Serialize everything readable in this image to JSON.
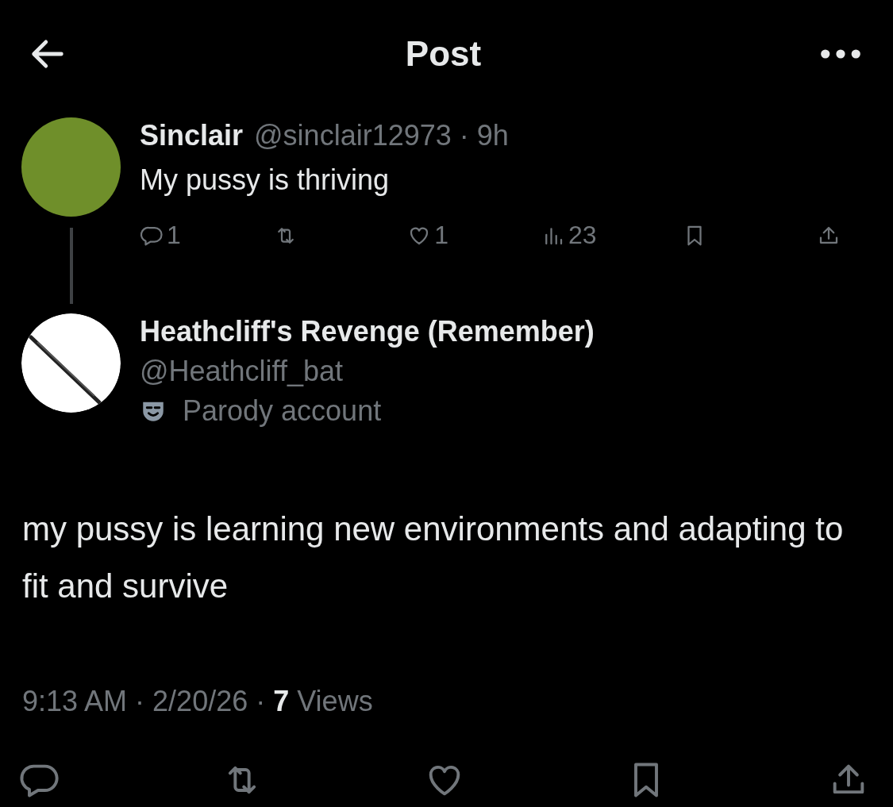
{
  "header": {
    "title": "Post"
  },
  "parent_post": {
    "name": "Sinclair",
    "handle_time": "@sinclair12973 · 9h",
    "text": "My pussy is thriving",
    "actions": [
      {
        "kind": "reply",
        "count": "1"
      },
      {
        "kind": "repost"
      },
      {
        "kind": "like",
        "count": "1"
      },
      {
        "kind": "views",
        "count": "23"
      },
      {
        "kind": "bookmark"
      },
      {
        "kind": "share"
      }
    ]
  },
  "post": {
    "name": "Heathcliff's Revenge (Remember)",
    "handle": "@Heathcliff_bat",
    "label": "Parody account",
    "text": "my pussy is learning new environments and adapting to fit and survive",
    "meta": [
      {
        "text": "9:13 AM",
        "kind": "plain"
      },
      {
        "text": "·",
        "kind": "plain"
      },
      {
        "text": "2/20/26",
        "kind": "plain"
      },
      {
        "text": "·",
        "kind": "plain"
      },
      {
        "text": "7",
        "kind": "bold"
      },
      {
        "text": "Views",
        "kind": "plain"
      }
    ],
    "actions": [
      {
        "kind": "reply"
      },
      {
        "kind": "repost"
      },
      {
        "kind": "like"
      },
      {
        "kind": "bookmark"
      },
      {
        "kind": "share"
      }
    ]
  }
}
